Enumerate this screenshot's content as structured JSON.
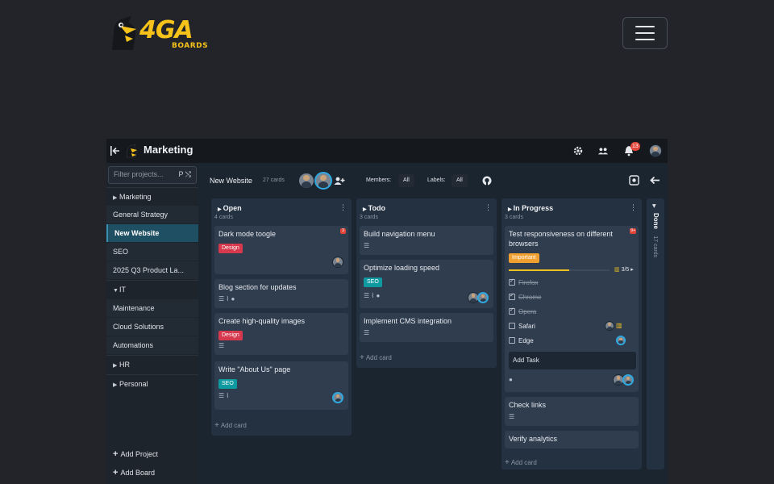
{
  "site": {
    "brand": "4GA",
    "brand_sub": "BOARDS"
  },
  "app": {
    "project_title": "Marketing",
    "notifications_count": "13"
  },
  "sidebar": {
    "filter_placeholder": "Filter projects...",
    "filter_shortcut": "P ⤭",
    "groups": [
      {
        "name": "Marketing",
        "boards": [
          "General Strategy",
          "New Website",
          "SEO",
          "2025 Q3 Product La..."
        ]
      },
      {
        "name": "IT",
        "boards": [
          "Maintenance",
          "Cloud Solutions",
          "Automations"
        ]
      },
      {
        "name": "HR",
        "boards": []
      },
      {
        "name": "Personal",
        "boards": []
      }
    ],
    "add_project": "Add Project",
    "add_board": "Add Board"
  },
  "board": {
    "name": "New Website",
    "count": "27 cards",
    "members_label": "Members:",
    "members_value": "All",
    "labels_label": "Labels:",
    "labels_value": "All"
  },
  "lists": {
    "open": {
      "title": "Open",
      "count": "4 cards",
      "cards": [
        {
          "title": "Dark mode toogle",
          "label": "Design",
          "badge": "3"
        },
        {
          "title": "Blog section for updates"
        },
        {
          "title": "Create high-quality images",
          "label": "Design"
        },
        {
          "title": "Write \"About Us\" page",
          "label": "SEO"
        }
      ],
      "add_card": "Add card"
    },
    "todo": {
      "title": "Todo",
      "count": "3 cards",
      "cards": [
        {
          "title": "Build navigation menu"
        },
        {
          "title": "Optimize loading speed",
          "label": "SEO"
        },
        {
          "title": "Implement CMS integration"
        }
      ],
      "add_card": "Add card"
    },
    "in_progress": {
      "title": "In Progress",
      "count": "3 cards",
      "cards": [
        {
          "title": "Test responsiveness on different browsers",
          "label": "Important",
          "badge": "9+",
          "progress": "3/5",
          "progress_fraction": 0.6,
          "tasks": [
            {
              "name": "Firefox",
              "done": true
            },
            {
              "name": "Chrome",
              "done": true
            },
            {
              "name": "Opera",
              "done": true
            },
            {
              "name": "Safari",
              "done": false
            },
            {
              "name": "Edge",
              "done": false
            }
          ],
          "add_task": "Add Task"
        },
        {
          "title": "Check links"
        },
        {
          "title": "Verify analytics"
        }
      ],
      "add_card": "Add card"
    },
    "done": {
      "title": "Done",
      "count": "17 cards"
    }
  },
  "colors": {
    "accent": "#2fa8e0",
    "design_label": "#d6394d",
    "seo_label": "#0f9aa0",
    "important_label": "#f0a030",
    "brand_yellow": "#f7c21a"
  }
}
